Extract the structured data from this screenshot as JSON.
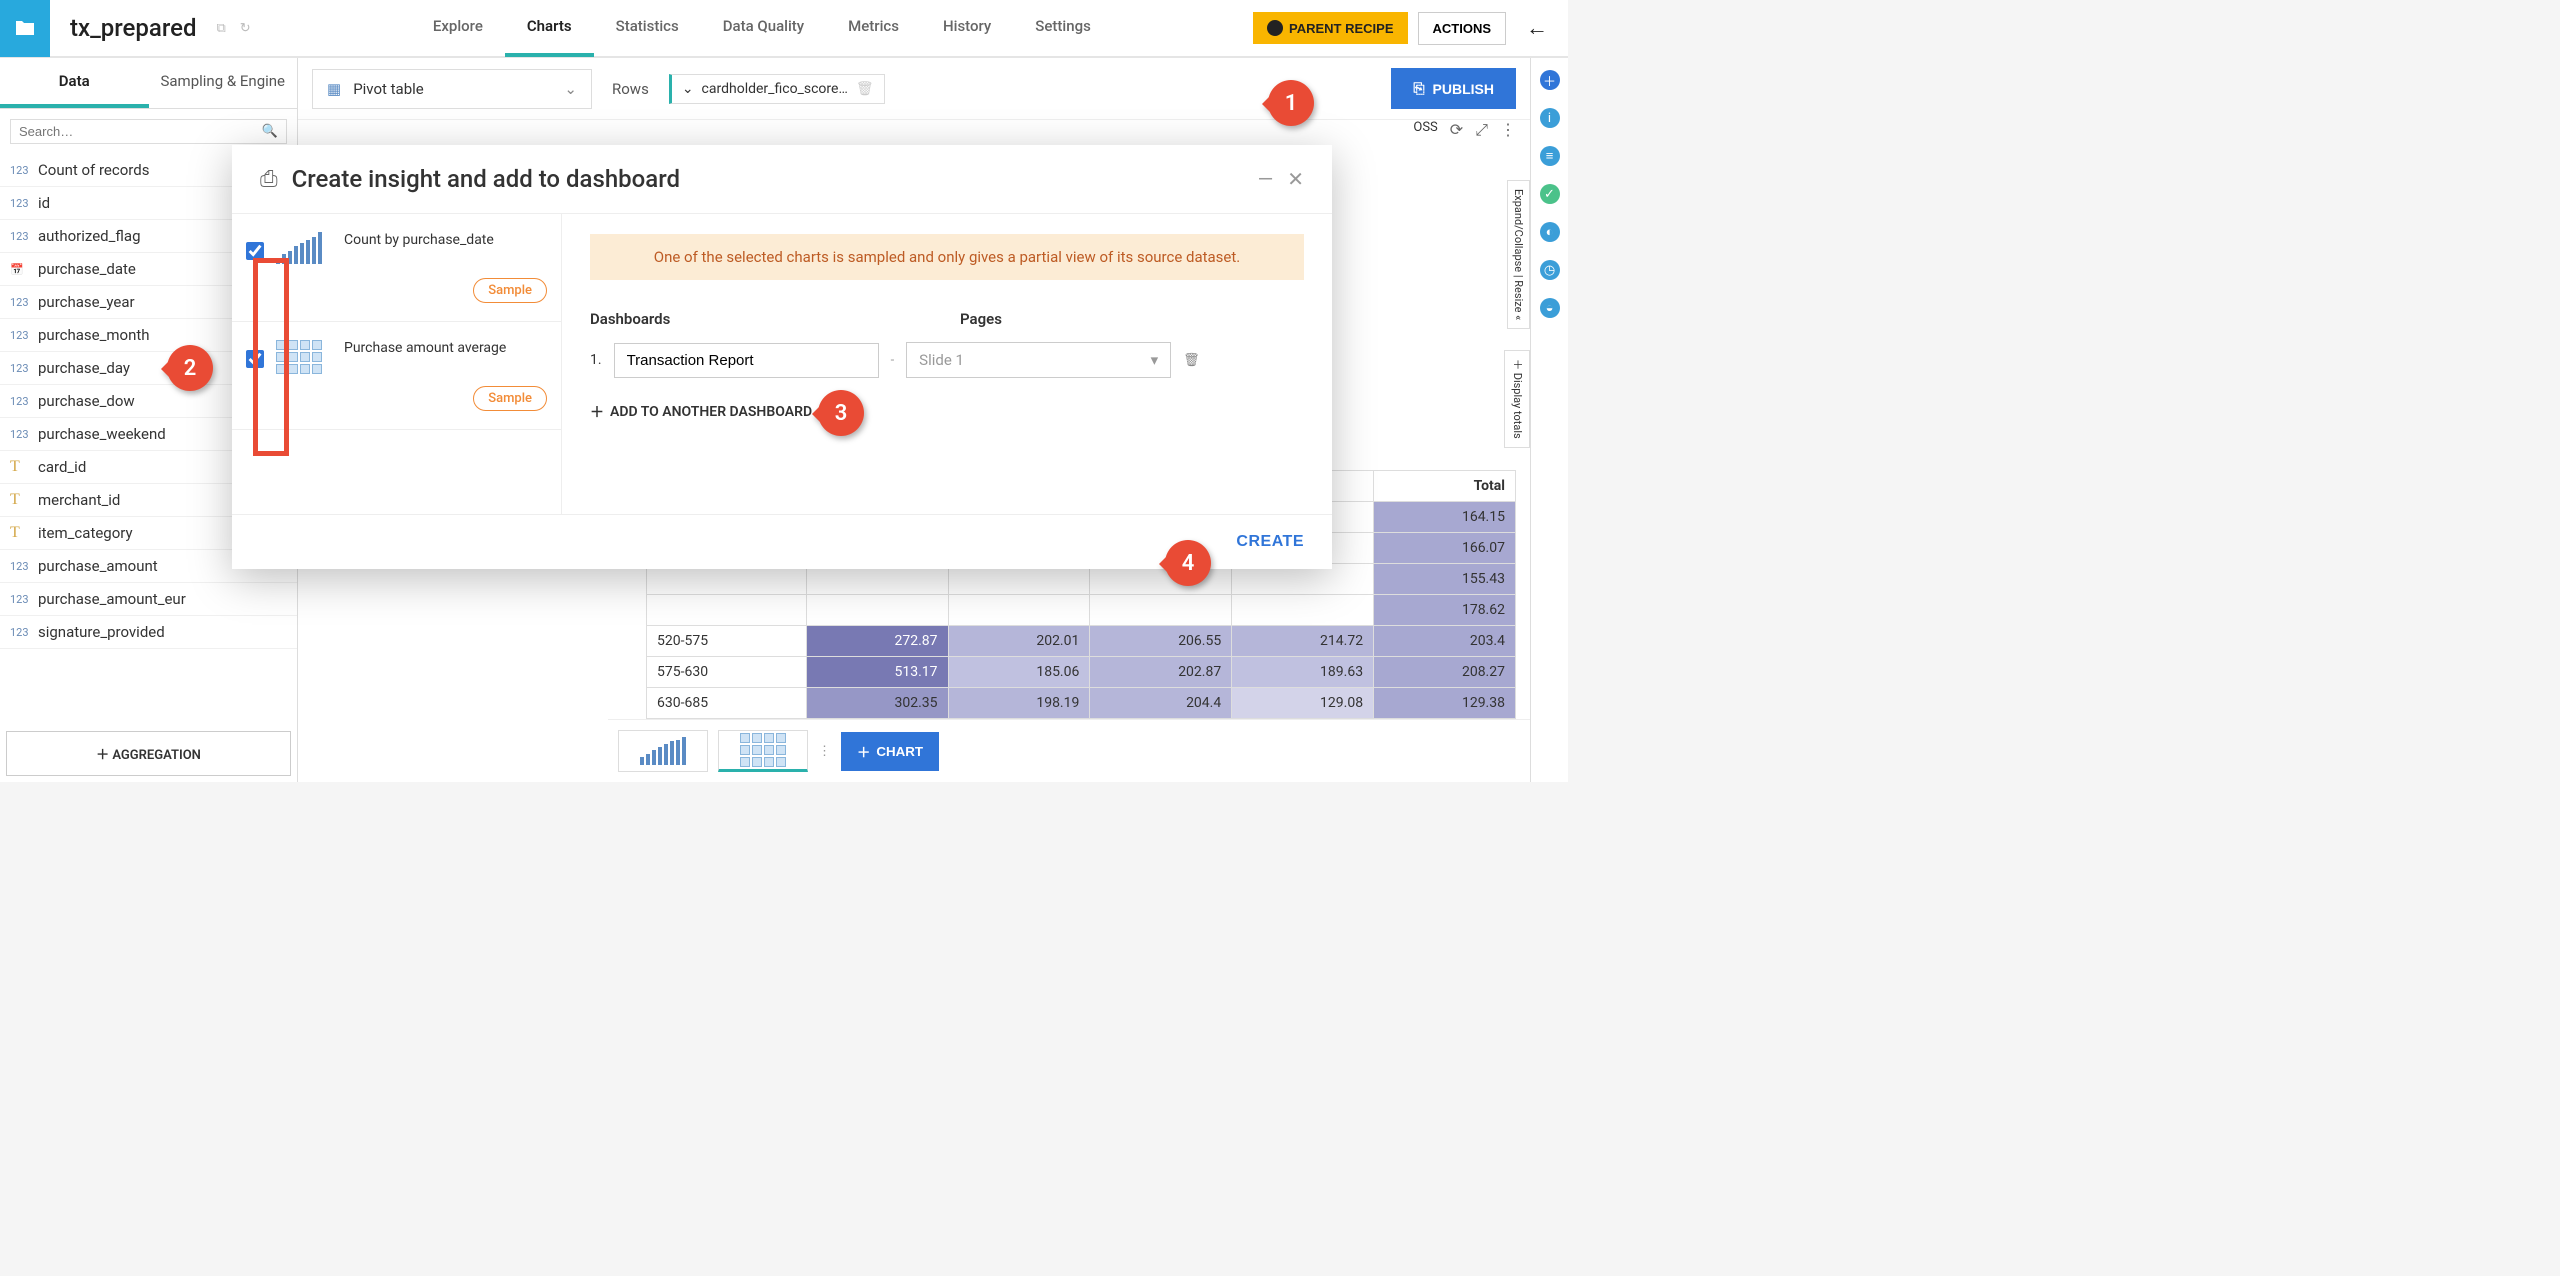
{
  "header": {
    "title": "tx_prepared",
    "tabs": [
      "Explore",
      "Charts",
      "Statistics",
      "Data Quality",
      "Metrics",
      "History",
      "Settings"
    ],
    "active_tab": "Charts",
    "parent_recipe": "PARENT RECIPE",
    "actions": "ACTIONS"
  },
  "sidebar": {
    "tabs": [
      "Data",
      "Sampling & Engine"
    ],
    "active": "Data",
    "search_placeholder": "Search…",
    "fields": [
      {
        "type": "123",
        "name": "Count of records"
      },
      {
        "type": "123",
        "name": "id"
      },
      {
        "type": "123",
        "name": "authorized_flag"
      },
      {
        "type": "date",
        "name": "purchase_date"
      },
      {
        "type": "123",
        "name": "purchase_year"
      },
      {
        "type": "123",
        "name": "purchase_month"
      },
      {
        "type": "123",
        "name": "purchase_day"
      },
      {
        "type": "123",
        "name": "purchase_dow"
      },
      {
        "type": "123",
        "name": "purchase_weekend"
      },
      {
        "type": "T",
        "name": "card_id"
      },
      {
        "type": "T",
        "name": "merchant_id"
      },
      {
        "type": "T",
        "name": "item_category"
      },
      {
        "type": "123",
        "name": "purchase_amount"
      },
      {
        "type": "123",
        "name": "purchase_amount_eur"
      },
      {
        "type": "123",
        "name": "signature_provided"
      }
    ],
    "aggregation": "AGGREGATION"
  },
  "chart": {
    "type_label": "Pivot table",
    "rows_label": "Rows",
    "row_chip": "cardholder_fico_score…",
    "publish": "PUBLISH",
    "add_chart": "CHART",
    "side_handle1": "Expand/Collapse | Resize",
    "side_handle2": "Display totals",
    "pivot_toolbar_label": "OSS"
  },
  "pivot_data": {
    "total_col_header": "Total",
    "rows": [
      {
        "label": "",
        "cells": [
          "",
          "",
          "",
          "",
          ""
        ],
        "total": "164.15"
      },
      {
        "label": "",
        "cells": [
          "",
          "",
          "",
          "",
          ""
        ],
        "total": "166.07"
      },
      {
        "label": "",
        "cells": [
          "",
          "",
          "",
          "",
          ""
        ],
        "total": "155.43"
      },
      {
        "label": "",
        "cells": [
          "",
          "",
          "",
          "",
          ""
        ],
        "total": "178.62"
      },
      {
        "label": "520-575",
        "cells": [
          "272.87",
          "202.01",
          "206.55",
          "214.72"
        ],
        "total": "203.4"
      },
      {
        "label": "575-630",
        "cells": [
          "513.17",
          "185.06",
          "202.87",
          "189.63"
        ],
        "total": "208.27"
      },
      {
        "label": "630-685",
        "cells": [
          "302.35",
          "198.19",
          "204.4",
          "129.08"
        ],
        "total": "129.38"
      }
    ]
  },
  "modal": {
    "title": "Create insight and add to dashboard",
    "insight1_title": "Count by purchase_date",
    "insight2_title": "Purchase amount average",
    "sample_label": "Sample",
    "warning": "One of the selected charts is sampled and only gives a partial view of its source dataset.",
    "dashboards_label": "Dashboards",
    "pages_label": "Pages",
    "dash_index": "1.",
    "dash_value": "Transaction Report",
    "dash_sep": "-",
    "page_placeholder": "Slide 1",
    "add_another": "ADD TO ANOTHER DASHBOARD",
    "create": "CREATE"
  },
  "callouts": {
    "c1": "1",
    "c2": "2",
    "c3": "3",
    "c4": "4"
  }
}
